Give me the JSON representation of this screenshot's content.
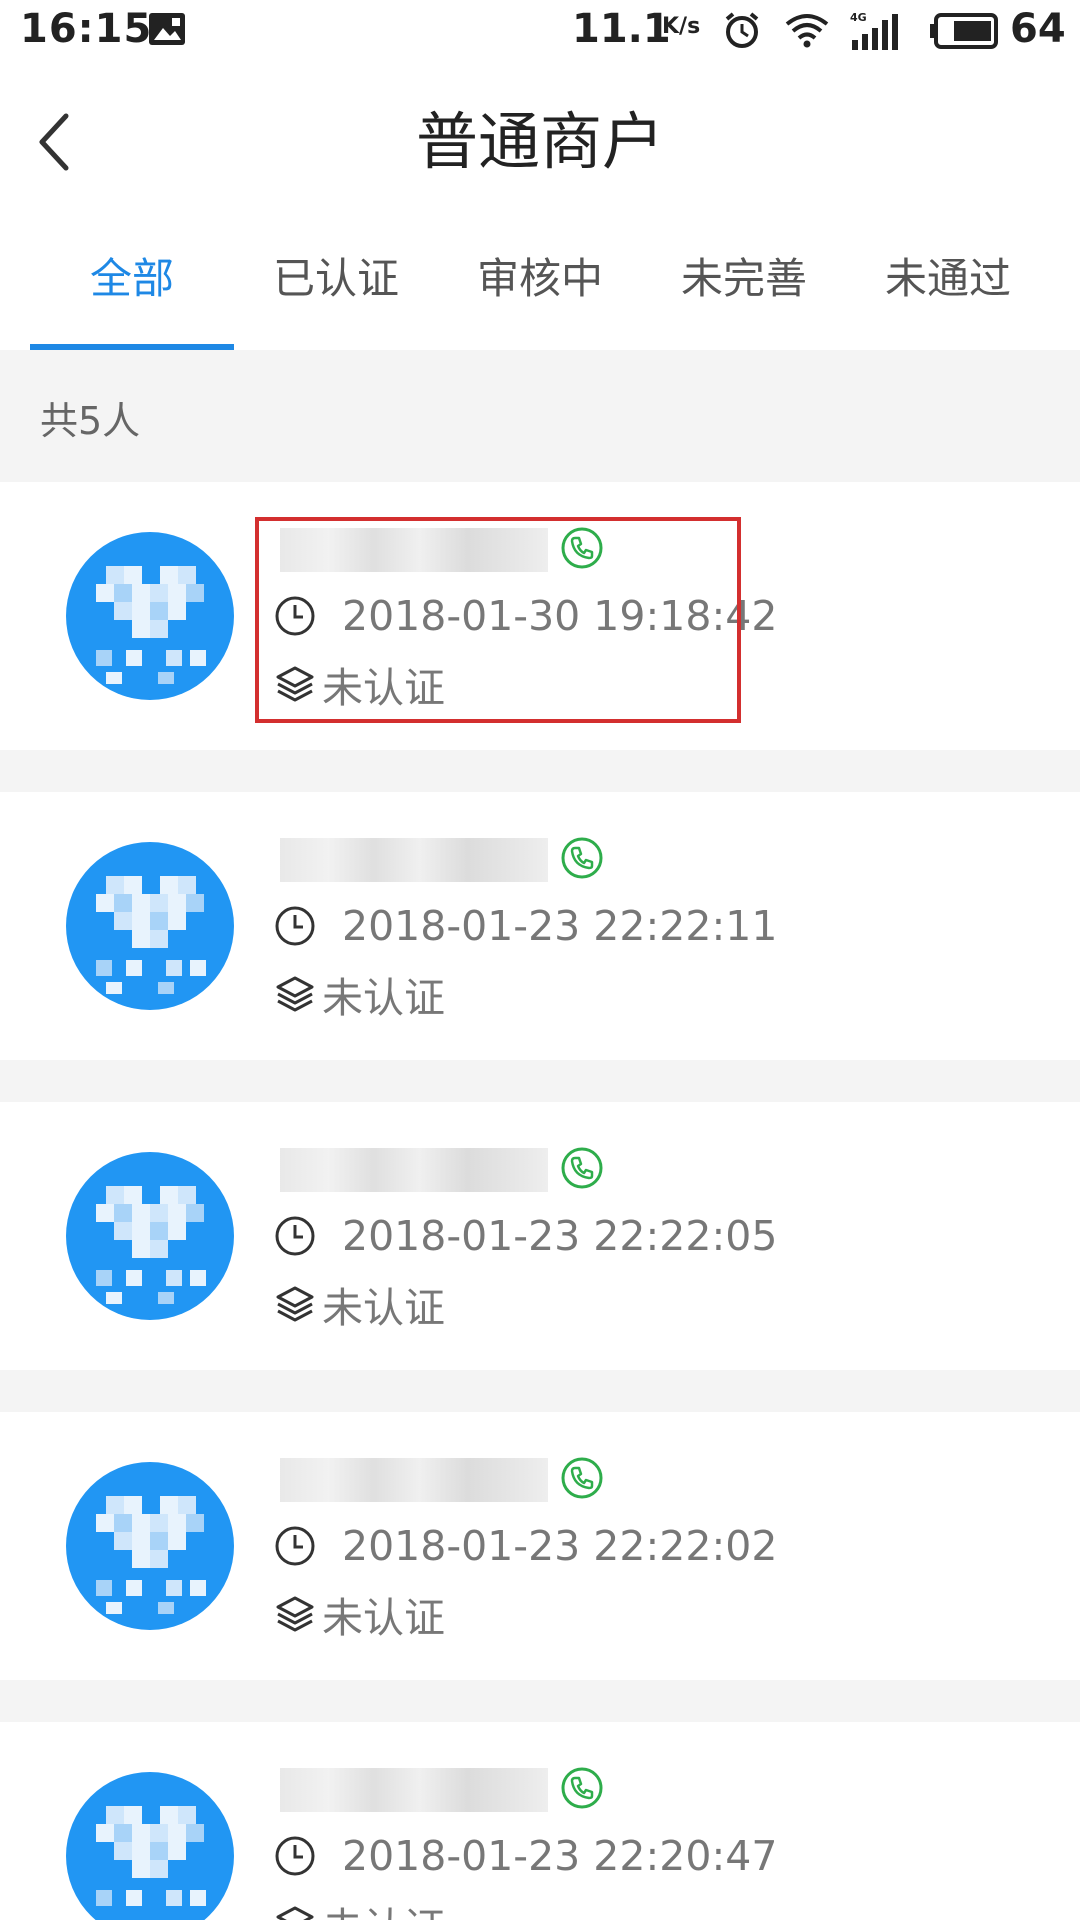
{
  "status_bar": {
    "time": "16:15",
    "net_speed": "11.1",
    "net_speed_unit": "K/s",
    "battery": "64",
    "icons": [
      "image-icon",
      "alarm-icon",
      "wifi-icon",
      "signal-4g-icon",
      "battery-icon"
    ]
  },
  "header": {
    "title": "普通商户",
    "back_icon": "chevron-left-icon"
  },
  "tabs": [
    {
      "label": "全部",
      "active": true
    },
    {
      "label": "已认证",
      "active": false
    },
    {
      "label": "审核中",
      "active": false
    },
    {
      "label": "未完善",
      "active": false
    },
    {
      "label": "未通过",
      "active": false
    }
  ],
  "count_text": "共5人",
  "items": [
    {
      "time": "2018-01-30 19:18:42",
      "status": "未认证",
      "highlighted": true
    },
    {
      "time": "2018-01-23 22:22:11",
      "status": "未认证",
      "highlighted": false
    },
    {
      "time": "2018-01-23 22:22:05",
      "status": "未认证",
      "highlighted": false
    },
    {
      "time": "2018-01-23 22:22:02",
      "status": "未认证",
      "highlighted": false
    },
    {
      "time": "2018-01-23 22:20:47",
      "status": "未认证",
      "highlighted": false
    }
  ],
  "colors": {
    "accent": "#1E88E5",
    "avatar": "#2196F3",
    "phone": "#2EAD4B",
    "highlight": "#D32F2F",
    "separator": "#f4f4f4"
  }
}
